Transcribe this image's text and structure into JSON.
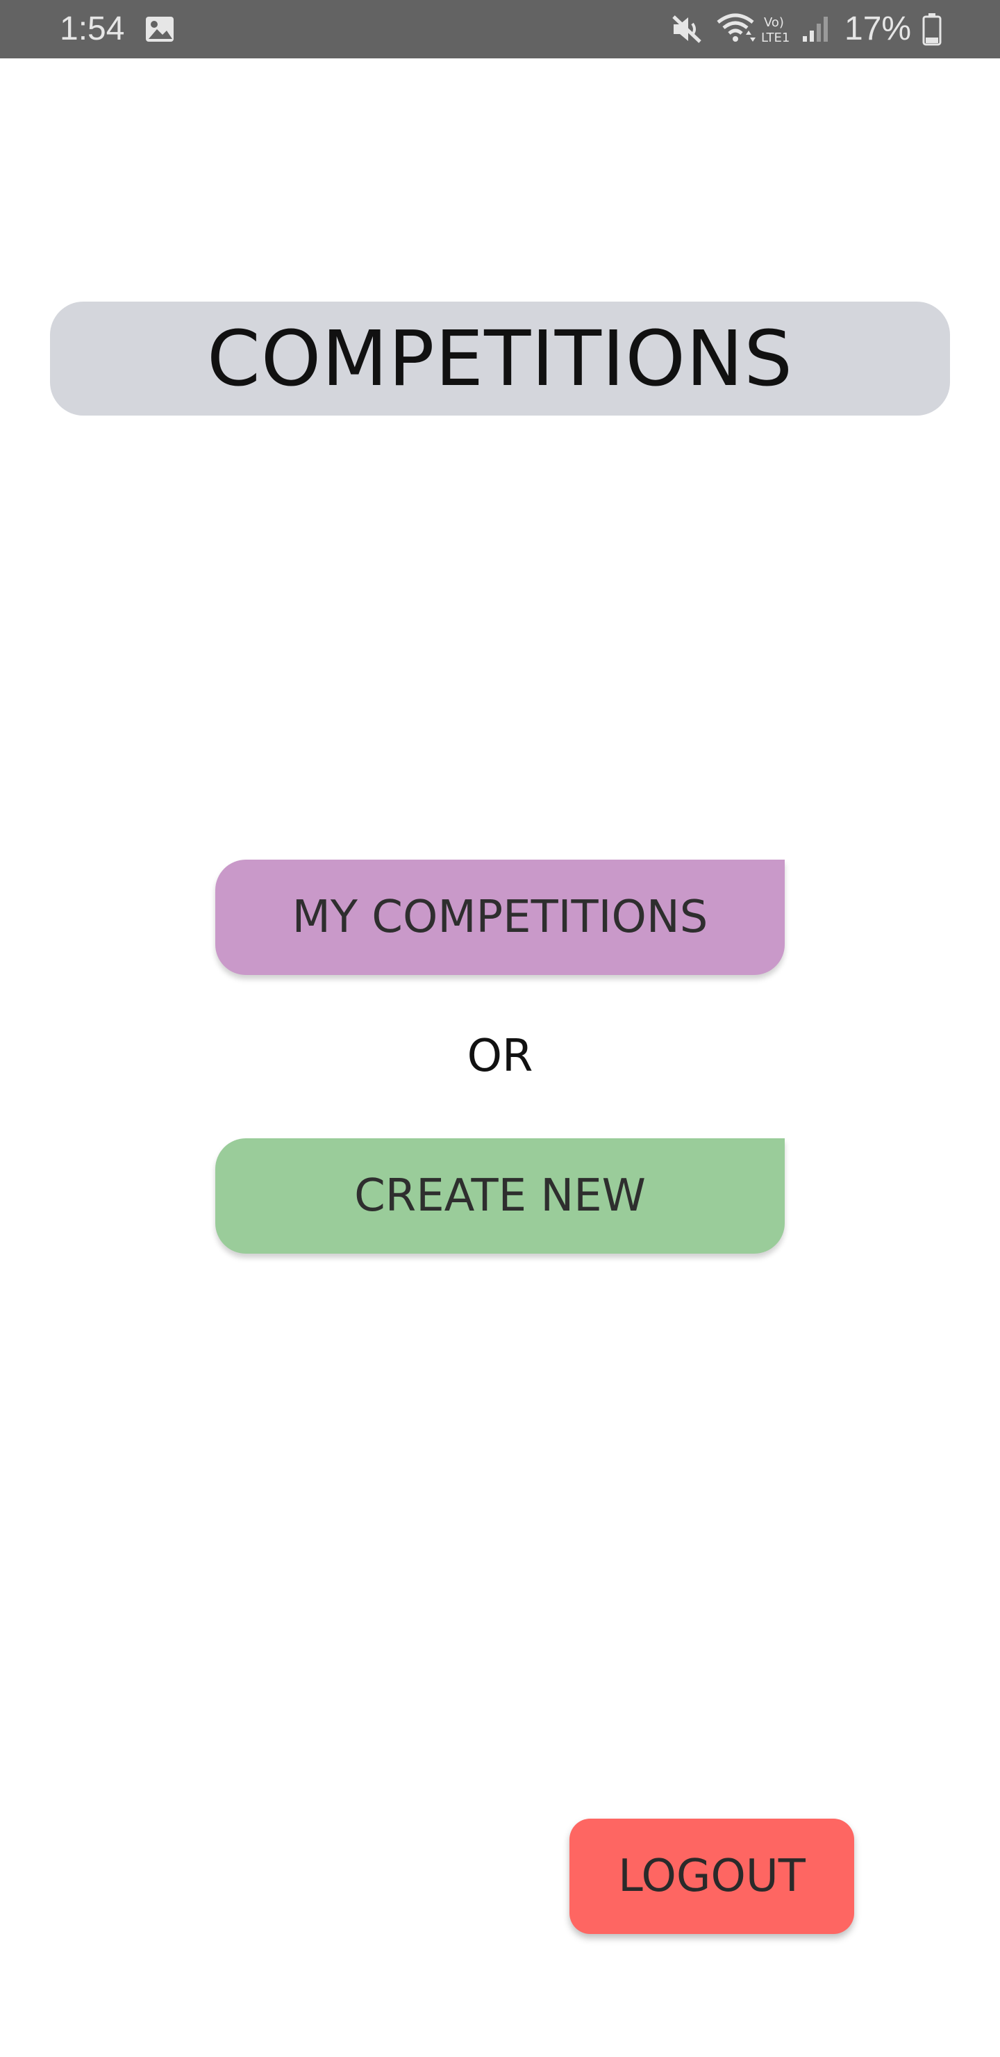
{
  "status_bar": {
    "time": "1:54",
    "battery": "17%",
    "network_label": "Vo) LTE1",
    "icons": [
      "gallery-icon",
      "mute-icon",
      "wifi-icon",
      "lte-icon",
      "signal-icon",
      "battery-icon"
    ]
  },
  "header": {
    "title": "COMPETITIONS"
  },
  "main": {
    "my_competitions_label": "MY COMPETITIONS",
    "or_label": "OR",
    "create_new_label": "CREATE NEW"
  },
  "footer": {
    "logout_label": "LOGOUT"
  },
  "colors": {
    "status_bar": "#636363",
    "title_background": "#d4d6dc",
    "my_competitions": "#c999c9",
    "create_new": "#9acc9a",
    "logout": "#fe6662"
  }
}
